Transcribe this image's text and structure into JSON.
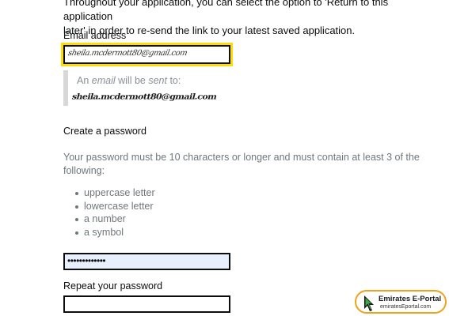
{
  "intro": {
    "line1": "Throughout your application, you can select the option to 'Return to this application",
    "line2": "later' in order to re-send the link to your latest saved application."
  },
  "email": {
    "label": "Email address",
    "value": "sheila.mcdermott80@gmail.com"
  },
  "inset": {
    "label_prefix": "An ",
    "label_italic1": "email",
    "label_mid": " will be ",
    "label_italic2": "sent",
    "label_suffix": " to:",
    "value": "sheila.mcdermott80@gmail.com"
  },
  "password": {
    "heading": "Create a password",
    "hint": "Your password must be 10 characters or longer and must contain at least 3 of the following:",
    "requirements": [
      "uppercase letter",
      "lowercase letter",
      "a number",
      "a symbol"
    ],
    "masked_value": "•••••••••••••"
  },
  "repeat": {
    "label": "Repeat your password",
    "value": ""
  },
  "watermark": {
    "title": "Emirates E-Portal",
    "url": "emiratesEportal.com",
    "accent": "#f0a21b"
  }
}
